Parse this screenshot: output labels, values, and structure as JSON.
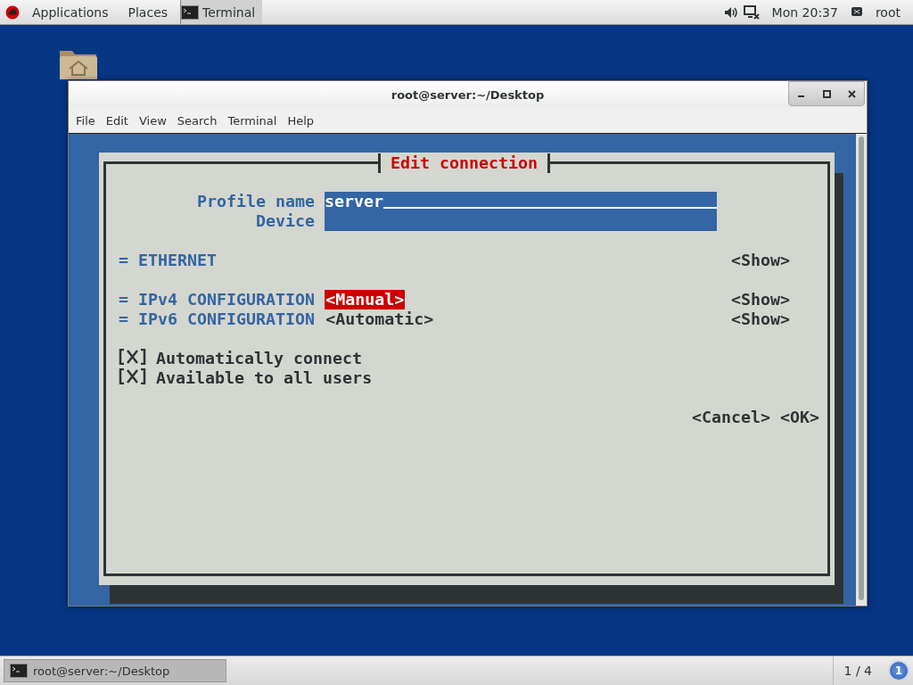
{
  "top_bar": {
    "applications": "Applications",
    "places": "Places",
    "active_app": "Terminal",
    "clock": "Mon 20:37",
    "user": "root"
  },
  "window": {
    "title": "root@server:~/Desktop",
    "menu": [
      "File",
      "Edit",
      "View",
      "Search",
      "Terminal",
      "Help"
    ]
  },
  "dialog": {
    "title": "Edit connection",
    "fields": [
      {
        "label": "Profile name",
        "value": "server",
        "focused": true
      },
      {
        "label": "Device",
        "focused": false
      }
    ],
    "sections": [
      {
        "label": "= ETHERNET",
        "show": "<Show>"
      },
      {
        "label": "= IPv4 CONFIGURATION",
        "mode": "<Manual>",
        "selected": true,
        "show": "<Show>"
      },
      {
        "label": "= IPv6 CONFIGURATION",
        "mode": "<Automatic>",
        "selected": false,
        "show": "<Show>"
      }
    ],
    "checkboxes": [
      {
        "checked": true,
        "label": "Automatically connect"
      },
      {
        "checked": true,
        "label": "Available to all users"
      }
    ],
    "buttons": [
      "<Cancel>",
      "<OK>"
    ]
  },
  "taskbar": {
    "window": "root@server:~/Desktop",
    "workspace_pager": "1 / 4",
    "workspace": "1"
  }
}
